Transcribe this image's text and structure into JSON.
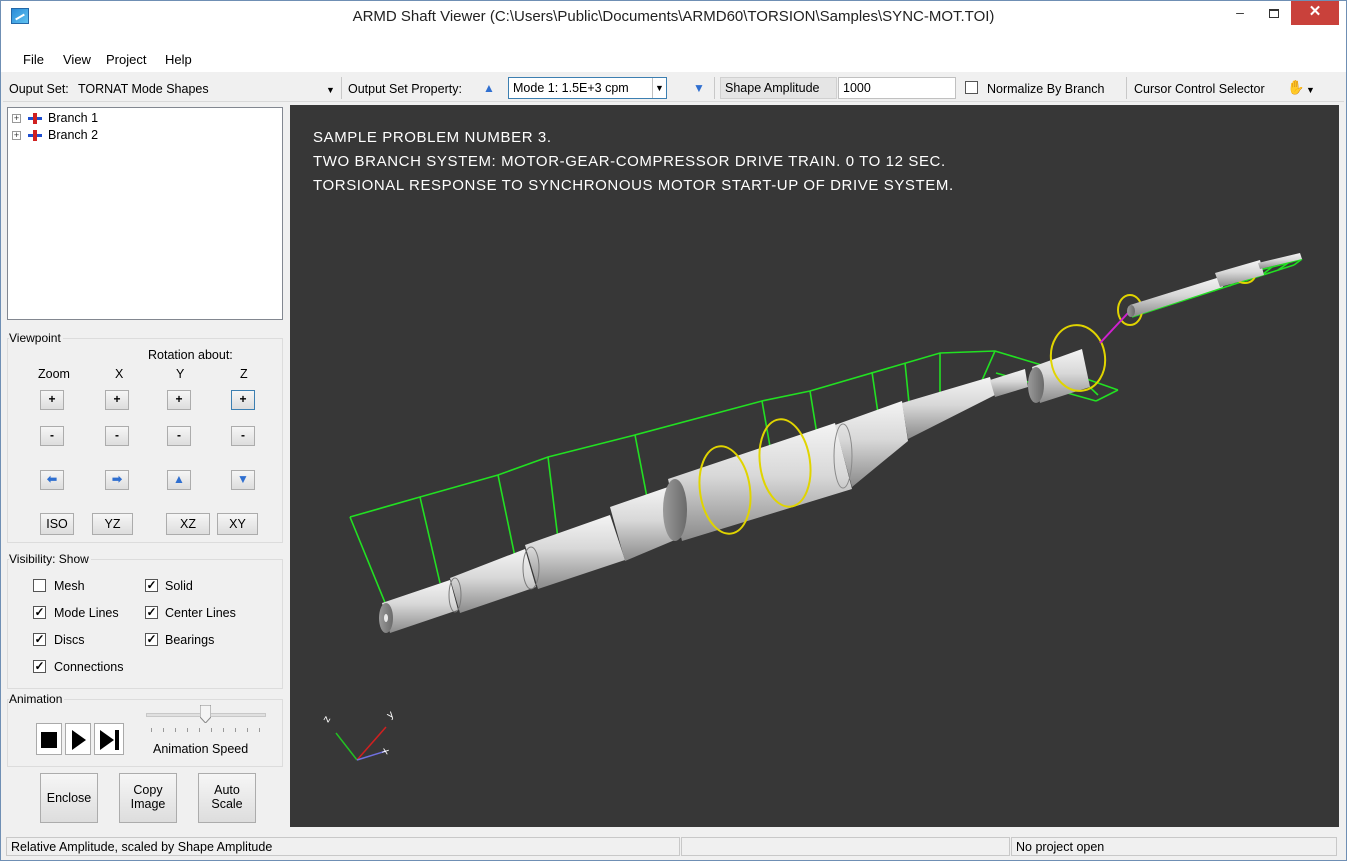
{
  "window": {
    "title": "ARMD Shaft Viewer (C:\\Users\\Public\\Documents\\ARMD60\\TORSION\\Samples\\SYNC-MOT.TOI)"
  },
  "menu": [
    "File",
    "View",
    "Project",
    "Help"
  ],
  "toolbar": {
    "output_set_label": "Ouput Set:",
    "output_set_value": "TORNAT Mode Shapes",
    "output_set_property_label": "Output Set Property:",
    "mode_value": "Mode 1:  1.5E+3 cpm",
    "shape_amplitude_label": "Shape Amplitude",
    "shape_amplitude_value": "1000",
    "normalize_label": "Normalize By Branch",
    "normalize_checked": false,
    "cursor_label": "Cursor Control Selector"
  },
  "tree": {
    "items": [
      {
        "label": "Branch 1"
      },
      {
        "label": "Branch 2"
      }
    ]
  },
  "viewpoint": {
    "title": "Viewpoint",
    "rotation_label": "Rotation about:",
    "zoom": "Zoom",
    "x": "X",
    "y": "Y",
    "z": "Z",
    "plus": "+",
    "minus": "-",
    "views": [
      "ISO",
      "YZ",
      "XZ",
      "XY"
    ]
  },
  "visibility": {
    "title": "Visibility: Show",
    "items": [
      {
        "label": "Mesh",
        "checked": false
      },
      {
        "label": "Solid",
        "checked": true
      },
      {
        "label": "Mode Lines",
        "checked": true
      },
      {
        "label": "Center Lines",
        "checked": true
      },
      {
        "label": "Discs",
        "checked": true
      },
      {
        "label": "Bearings",
        "checked": true
      },
      {
        "label": "Connections",
        "checked": true
      }
    ]
  },
  "animation": {
    "title": "Animation",
    "speed_label": "Animation Speed",
    "speed_fraction": 0.5
  },
  "actions": {
    "enclose": "Enclose",
    "copy_image": "Copy\nImage",
    "copy_line1": "Copy",
    "copy_line2": "Image",
    "auto_line1": "Auto",
    "auto_line2": "Scale"
  },
  "viewport": {
    "lines": [
      "SAMPLE PROBLEM NUMBER 3.",
      "TWO BRANCH SYSTEM: MOTOR-GEAR-COMPRESSOR DRIVE TRAIN. 0 TO 12 SEC.",
      "TORSIONAL RESPONSE TO SYNCHRONOUS MOTOR START-UP OF DRIVE SYSTEM."
    ],
    "background": "#373737",
    "mode_line_color": "#22e022",
    "disc_color": "#e0d400",
    "connection_color": "#d020d0"
  },
  "status": {
    "left": "Relative Amplitude, scaled by Shape Amplitude",
    "middle": "",
    "right": "No project open"
  }
}
